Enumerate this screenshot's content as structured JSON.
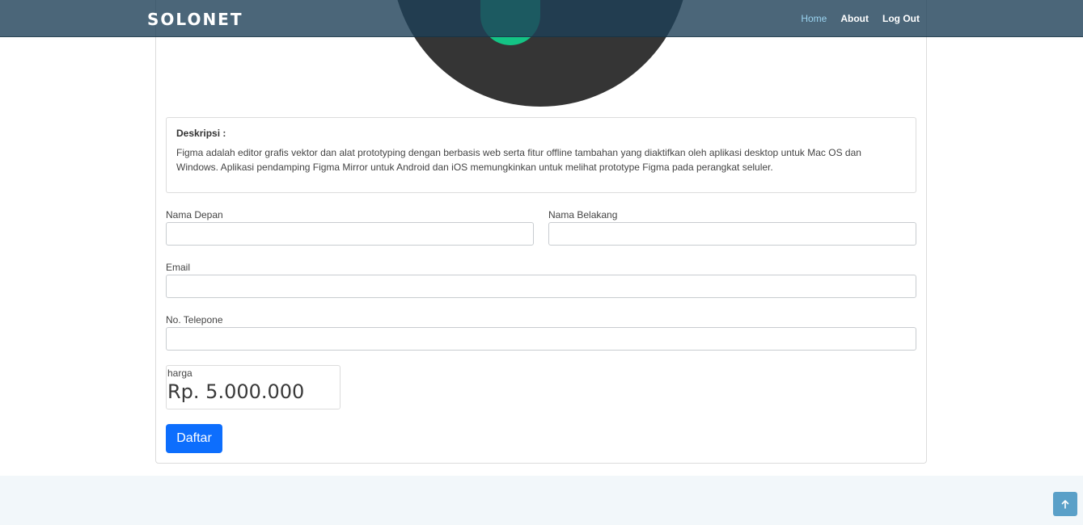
{
  "navbar": {
    "brand": "SOLONET",
    "links": [
      {
        "label": "Home",
        "active": true
      },
      {
        "label": "About",
        "active": false
      },
      {
        "label": "Log Out",
        "active": false
      }
    ]
  },
  "description": {
    "title": "Deskripsi :",
    "text": "Figma adalah editor grafis vektor dan alat prototyping dengan berbasis web serta fitur offline tambahan yang diaktifkan oleh aplikasi desktop untuk Mac OS dan Windows. Aplikasi pendamping Figma Mirror untuk Android dan iOS memungkinkan untuk melihat prototype Figma pada perangkat seluler."
  },
  "form": {
    "first_name": {
      "label": "Nama Depan",
      "value": ""
    },
    "last_name": {
      "label": "Nama Belakang",
      "value": ""
    },
    "email": {
      "label": "Email",
      "value": ""
    },
    "phone": {
      "label": "No. Telepone",
      "value": ""
    },
    "price": {
      "label": "harga",
      "value": "Rp. 5.000.000"
    },
    "submit_label": "Daftar"
  },
  "colors": {
    "navbar_bg": "#1e4058",
    "primary_button": "#0d6efd",
    "hero_circle": "#353535",
    "hero_accent": "#14c485",
    "scroll_top_button": "#5aa0c8",
    "footer_bg": "#f2f7fa"
  },
  "icons": {
    "scroll_top": "arrow-up-icon"
  }
}
